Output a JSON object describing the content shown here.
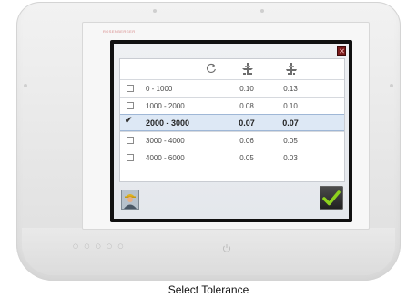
{
  "device": {
    "brand": "ROSENBERGER"
  },
  "table": {
    "header_icons": [
      "rotate-icon",
      "cutter-icon-1",
      "cutter-icon-2"
    ],
    "rows": [
      {
        "range": "0 - 1000",
        "v1": "0.10",
        "v2": "0.13",
        "checked": false
      },
      {
        "range": "1000 - 2000",
        "v1": "0.08",
        "v2": "0.10",
        "checked": false
      },
      {
        "range": "2000 - 3000",
        "v1": "0.07",
        "v2": "0.07",
        "checked": true
      },
      {
        "range": "3000 - 4000",
        "v1": "0.06",
        "v2": "0.05",
        "checked": false
      },
      {
        "range": "4000 - 6000",
        "v1": "0.05",
        "v2": "0.03",
        "checked": false
      }
    ]
  },
  "checkbox_mark": "✔",
  "colors": {
    "close_button": "#7a1c1c",
    "ok_check": "#8dd21e",
    "selected_row": "#dde8f5"
  },
  "status": {
    "leds": "○ ○ ○ ○ ○"
  },
  "caption": "Select Tolerance"
}
